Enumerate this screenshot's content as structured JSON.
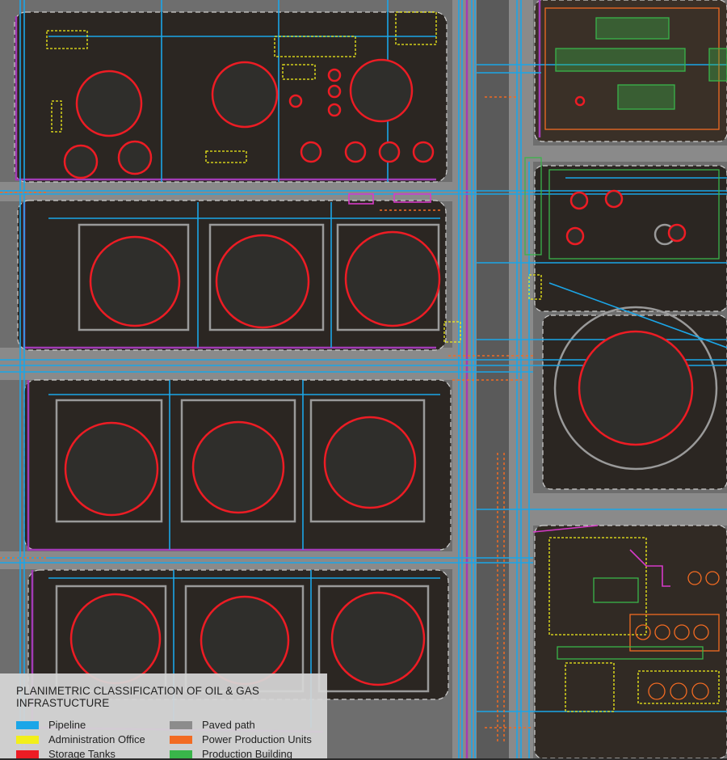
{
  "legend": {
    "title": "PLANIMETRIC CLASSIFICATION OF OIL & GAS INFRASTUCTURE",
    "items": [
      {
        "label": "Pipeline",
        "color": "#1ba6e8"
      },
      {
        "label": "Paved path",
        "color": "#8c8c8c"
      },
      {
        "label": "Administration Office",
        "color": "#f2ef1a"
      },
      {
        "label": "Power Production Units",
        "color": "#f26b22"
      },
      {
        "label": "Storage Tanks",
        "color": "#ed1c24"
      },
      {
        "label": "Production Building",
        "color": "#39b54a"
      }
    ]
  },
  "colors": {
    "pipeline": "#1ba6e8",
    "paved": "#8c8c8c",
    "admin": "#f2ef1a",
    "power": "#f26b22",
    "tank": "#ed1c24",
    "production": "#39b54a",
    "boundary": "#a23bb5",
    "ground": "#2a2622"
  }
}
